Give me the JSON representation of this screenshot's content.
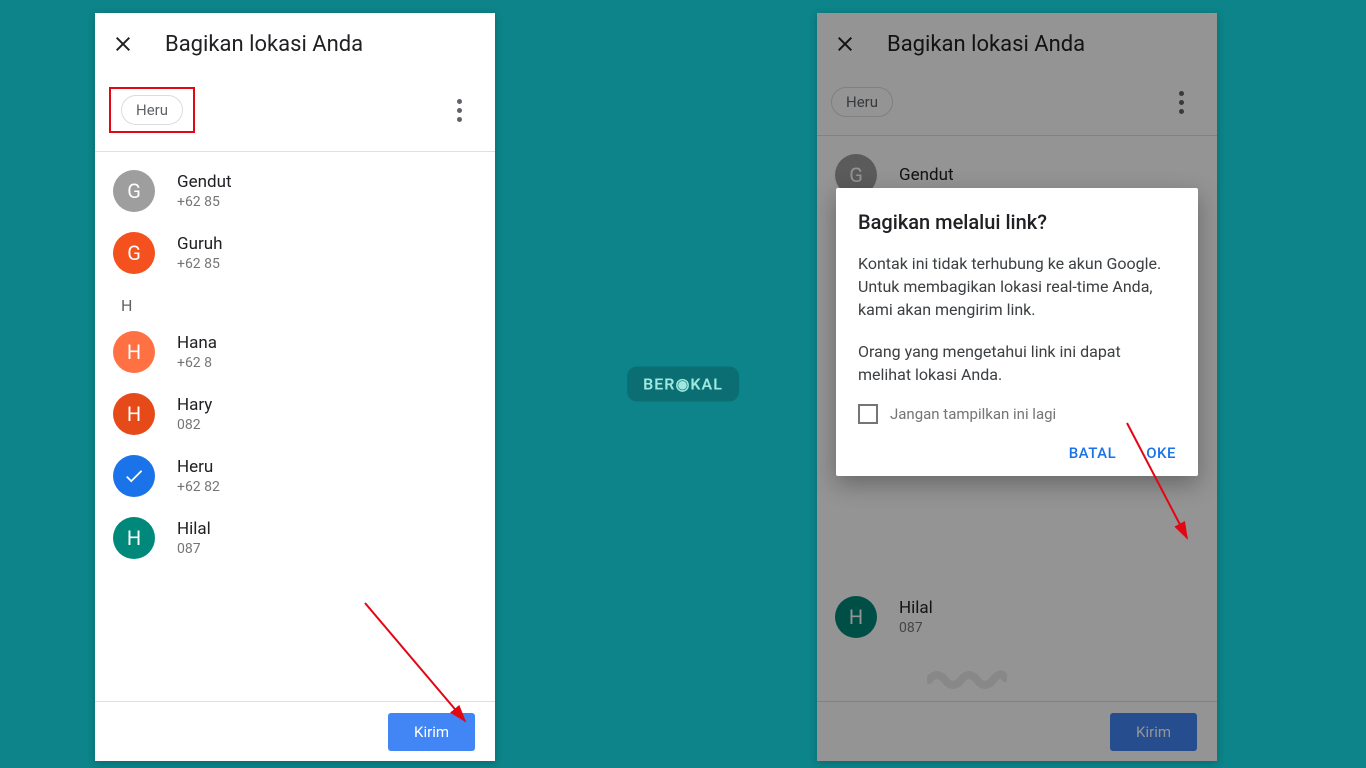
{
  "logo": "BER◉KAL",
  "colors": {
    "primary": "#1a73e8",
    "send": "#4285f4",
    "highlight": "#e30613",
    "bg": "#0c8489"
  },
  "left": {
    "title": "Bagikan lokasi Anda",
    "chip": "Heru",
    "section_letter": "H",
    "contacts": [
      {
        "letter": "G",
        "name": "Gendut",
        "sub": "+62 85",
        "avatar_class": "avatar-gray"
      },
      {
        "letter": "G",
        "name": "Guruh",
        "sub": "+62 85",
        "avatar_class": "avatar-orange"
      },
      {
        "letter": "H",
        "name": "Hana",
        "sub": "+62 8",
        "avatar_class": "avatar-orange2"
      },
      {
        "letter": "H",
        "name": "Hary",
        "sub": "082",
        "avatar_class": "avatar-red"
      },
      {
        "letter": "✓",
        "name": "Heru",
        "sub": "+62 82",
        "avatar_class": "avatar-blue",
        "selected": true
      },
      {
        "letter": "H",
        "name": "Hilal",
        "sub": "087",
        "avatar_class": "avatar-teal"
      }
    ],
    "send": "Kirim"
  },
  "right": {
    "title": "Bagikan lokasi Anda",
    "chip": "Heru",
    "contacts_visible": [
      {
        "letter": "G",
        "name": "Gendut",
        "avatar_class": "avatar-gray"
      },
      {
        "letter": "H",
        "name": "Hilal",
        "sub": "087",
        "avatar_class": "avatar-teal"
      }
    ],
    "send": "Kirim",
    "dialog": {
      "title": "Bagikan melalui link?",
      "text1": "Kontak ini tidak terhubung ke akun Google. Untuk membagikan lokasi real-time Anda, kami akan mengirim link.",
      "text2": "Orang yang mengetahui link ini dapat melihat lokasi Anda.",
      "checkbox": "Jangan tampilkan ini lagi",
      "cancel": "BATAL",
      "ok": "OKE"
    }
  }
}
